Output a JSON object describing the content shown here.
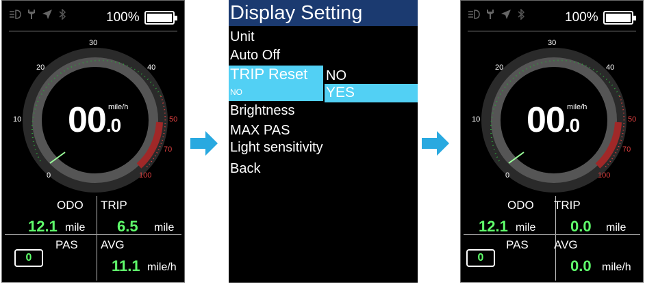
{
  "screen_left": {
    "battery": "100%",
    "speed_int": "00",
    "speed_dec": ".0",
    "speed_unit": "mile/h",
    "gauge_ticks": [
      "0",
      "10",
      "20",
      "30",
      "40",
      "50",
      "70",
      "100"
    ],
    "odo_label": "ODO",
    "odo_value": "12.1",
    "odo_unit": "mile",
    "trip_label": "TRIP",
    "trip_value": "6.5",
    "trip_unit": "mile",
    "pas_label": "PAS",
    "pas_value": "0",
    "avg_label": "AVG",
    "avg_value": "11.1",
    "avg_unit": "mile/h"
  },
  "menu": {
    "title": "Display Setting",
    "items": [
      "Unit",
      "Auto Off",
      "TRIP Reset",
      "Brightness",
      "MAX PAS",
      "Light sensitivity",
      "Back"
    ],
    "trip_reset_current": "NO",
    "options": [
      "NO",
      "YES"
    ],
    "selected_option": "YES"
  },
  "screen_right": {
    "battery": "100%",
    "speed_int": "00",
    "speed_dec": ".0",
    "speed_unit": "mile/h",
    "gauge_ticks": [
      "0",
      "10",
      "20",
      "30",
      "40",
      "50",
      "70",
      "100"
    ],
    "odo_label": "ODO",
    "odo_value": "12.1",
    "odo_unit": "mile",
    "trip_label": "TRIP",
    "trip_value": "0.0",
    "trip_unit": "mile",
    "pas_label": "PAS",
    "pas_value": "0",
    "avg_label": "AVG",
    "avg_value": "0.0",
    "avg_unit": "mile/h"
  },
  "colors": {
    "value_green": "#5fff6b",
    "highlight_blue": "#52d0f4",
    "title_bar": "#1b3a70",
    "arrow": "#29a9e0",
    "gauge_red": "#e04040"
  },
  "icons": [
    "headlight-icon",
    "wrench-icon",
    "navigation-icon",
    "bluetooth-icon",
    "battery-icon",
    "arrow-right-icon"
  ]
}
